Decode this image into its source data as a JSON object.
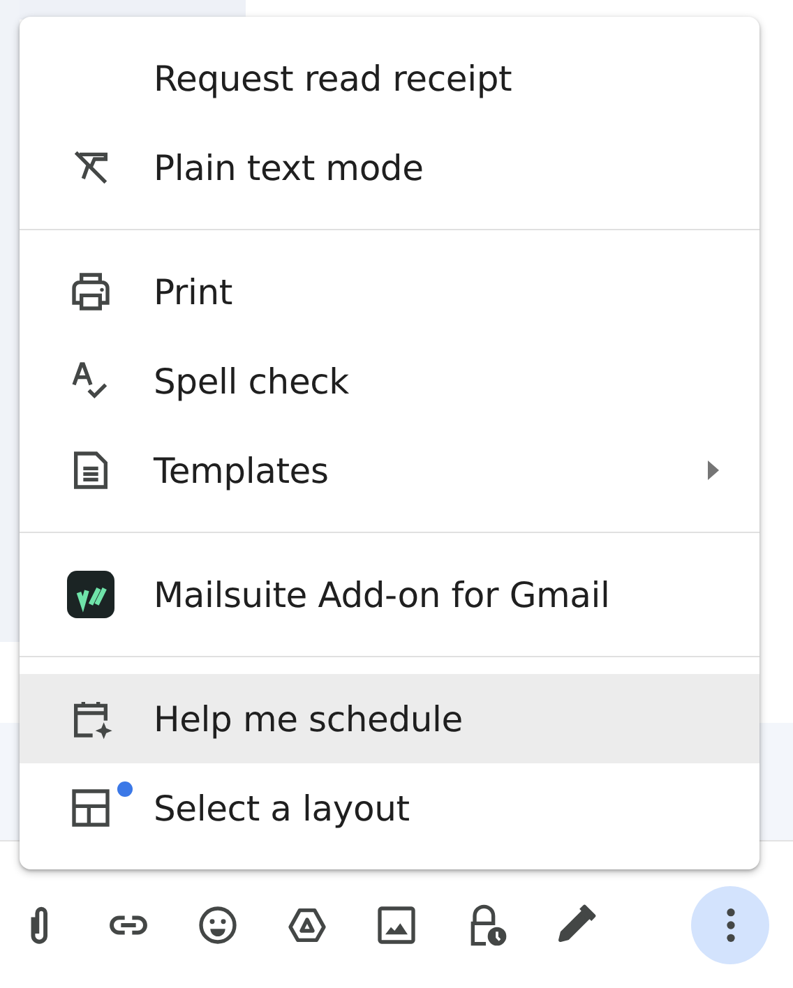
{
  "menu": {
    "sections": [
      {
        "items": [
          {
            "label": "Request read receipt",
            "selected": false,
            "submenu": false,
            "new_dot": false
          },
          {
            "label": "Plain text mode",
            "selected": false,
            "submenu": false,
            "new_dot": false
          }
        ]
      },
      {
        "items": [
          {
            "label": "Print",
            "selected": false,
            "submenu": false,
            "new_dot": false
          },
          {
            "label": "Spell check",
            "selected": false,
            "submenu": false,
            "new_dot": false
          },
          {
            "label": "Templates",
            "selected": false,
            "submenu": true,
            "new_dot": false
          }
        ]
      },
      {
        "items": [
          {
            "label": "Mailsuite Add-on for Gmail",
            "selected": false,
            "submenu": false,
            "new_dot": false
          }
        ]
      },
      {
        "items": [
          {
            "label": "Help me schedule",
            "selected": true,
            "submenu": false,
            "new_dot": false
          },
          {
            "label": "Select a layout",
            "selected": false,
            "submenu": false,
            "new_dot": true
          }
        ]
      }
    ]
  },
  "toolbar": [
    {
      "active": false
    },
    {
      "active": false
    },
    {
      "active": false
    },
    {
      "active": false
    },
    {
      "active": false
    },
    {
      "active": false
    },
    {
      "active": false
    },
    {
      "active": true
    }
  ]
}
